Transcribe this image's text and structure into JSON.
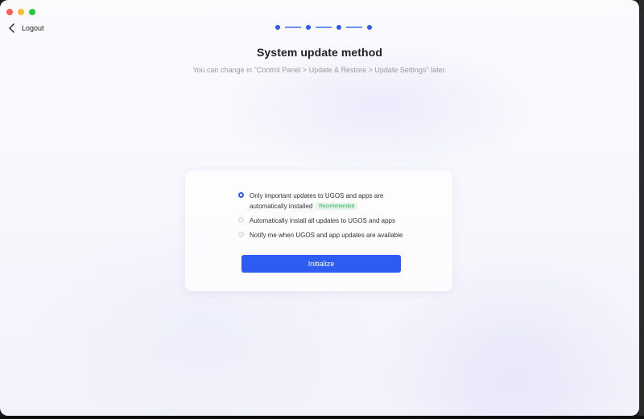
{
  "header": {
    "logout_label": "Logout"
  },
  "stepper": {
    "total_steps": 4,
    "active_steps": 4
  },
  "main": {
    "title": "System update method",
    "subtitle": "You can change in \"Control Panel > Update & Restore > Update Settings\" later."
  },
  "options": [
    {
      "label_line1": "Only important updates to UGOS and apps are",
      "label_line2": "automatically installed",
      "badge": "Recommended",
      "selected": true
    },
    {
      "label": "Automatically install all updates to UGOS and apps",
      "selected": false
    },
    {
      "label": "Notify me when UGOS and app updates are available",
      "selected": false
    }
  ],
  "actions": {
    "initialize_label": "Initialize"
  },
  "colors": {
    "accent": "#2c5cf2",
    "badge_text": "#2fa655",
    "badge_bg": "#e2f5e7"
  }
}
